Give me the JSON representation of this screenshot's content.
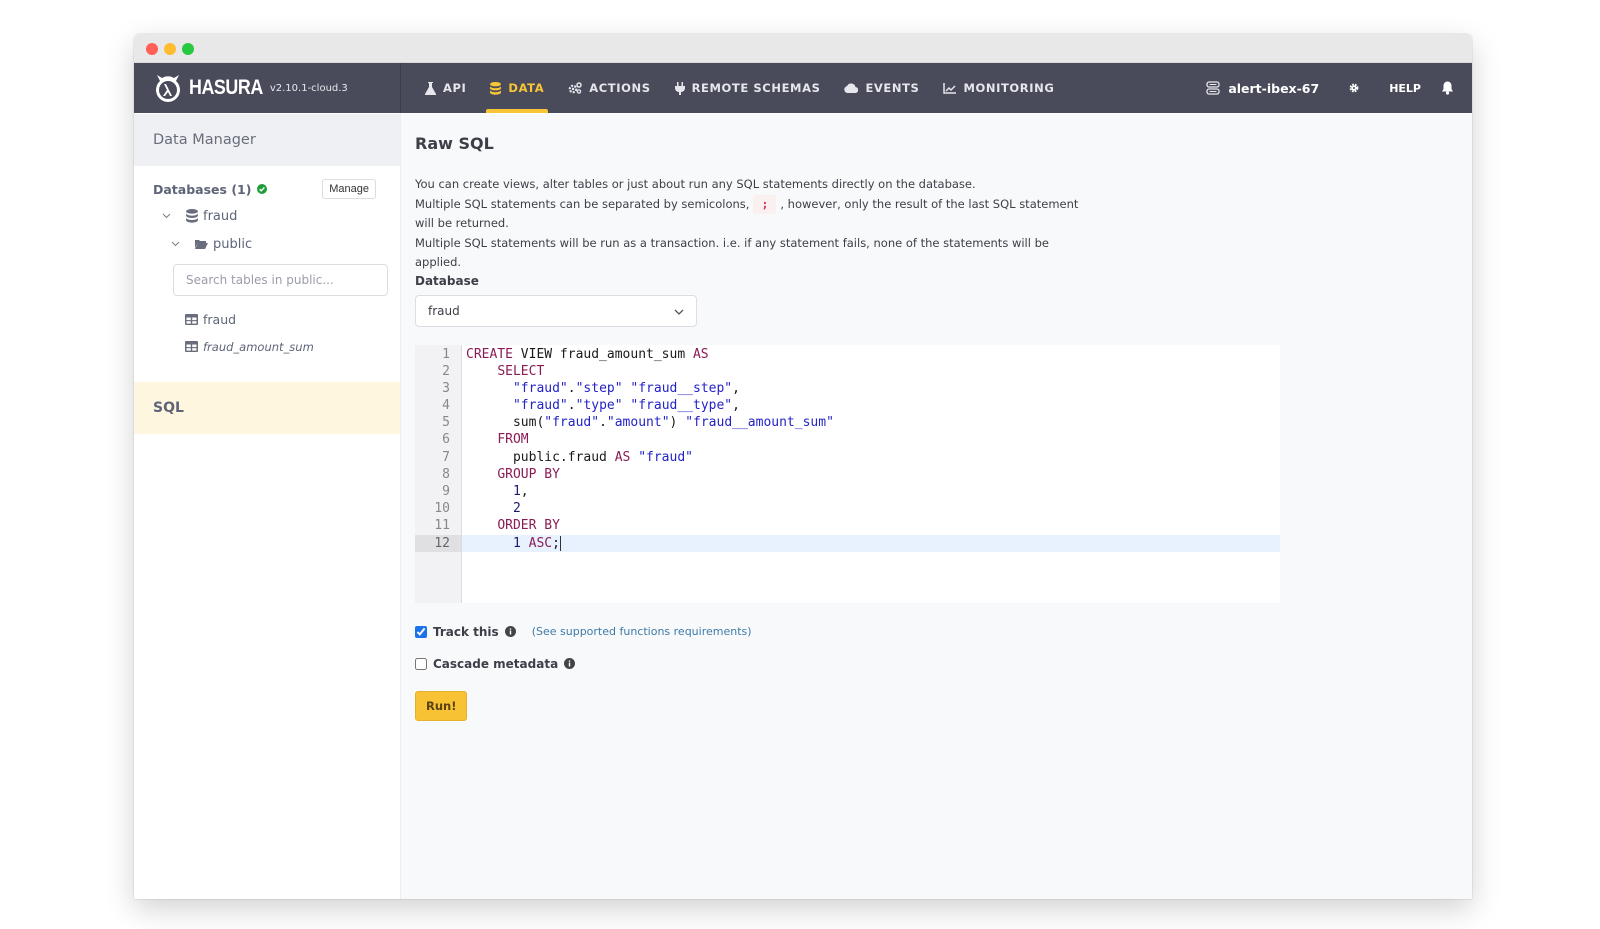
{
  "window": {
    "controls": [
      "close",
      "minimize",
      "maximize"
    ]
  },
  "navbar": {
    "brand_name": "HASURA",
    "version": "v2.10.1-cloud.3",
    "items": [
      {
        "label": "API",
        "icon": "flask-icon",
        "active": false
      },
      {
        "label": "DATA",
        "icon": "database-icon",
        "active": true
      },
      {
        "label": "ACTIONS",
        "icon": "cogs-icon",
        "active": false
      },
      {
        "label": "REMOTE SCHEMAS",
        "icon": "plug-icon",
        "active": false
      },
      {
        "label": "EVENTS",
        "icon": "cloud-icon",
        "active": false
      },
      {
        "label": "MONITORING",
        "icon": "chart-line-icon",
        "active": false
      }
    ],
    "project_name": "alert-ibex-67",
    "help_label": "HELP"
  },
  "sidebar": {
    "header": "Data Manager",
    "databases_label": "Databases (1)",
    "manage_label": "Manage",
    "database": "fraud",
    "schema": "public",
    "search_placeholder": "Search tables in public...",
    "tables": [
      {
        "name": "fraud",
        "type": "table"
      },
      {
        "name": "fraud_amount_sum",
        "type": "view"
      }
    ],
    "sql_label": "SQL"
  },
  "main": {
    "title": "Raw SQL",
    "desc_line1": "You can create views, alter tables or just about run any SQL statements directly on the database.",
    "desc_line2_a": "Multiple SQL statements can be separated by semicolons,",
    "desc_semicolon": ";",
    "desc_line2_b": ", however, only the result of the last SQL statement will be returned.",
    "desc_line3": "Multiple SQL statements will be run as a transaction. i.e. if any statement fails, none of the statements will be applied.",
    "database_label": "Database",
    "database_selected": "fraud",
    "editor": {
      "active_line": 12,
      "lines": [
        "CREATE VIEW fraud_amount_sum AS",
        "    SELECT",
        "      \"fraud\".\"step\" \"fraud__step\",",
        "      \"fraud\".\"type\" \"fraud__type\",",
        "      sum(\"fraud\".\"amount\") \"fraud__amount_sum\"",
        "    FROM",
        "      public.fraud AS \"fraud\"",
        "    GROUP BY",
        "      1,",
        "      2",
        "    ORDER BY",
        "      1 ASC;"
      ]
    },
    "track_this_label": "Track this",
    "track_this_checked": true,
    "supported_functions_link": "(See supported functions requirements)",
    "cascade_label": "Cascade metadata",
    "cascade_checked": false,
    "run_label": "Run!"
  },
  "colors": {
    "navbar_bg": "#494b5a",
    "accent_yellow": "#f7c536",
    "sql_section_bg": "#fff6df",
    "success_green": "#1f9d3a",
    "keyword": "#8a1c55",
    "string": "#2323c8"
  }
}
